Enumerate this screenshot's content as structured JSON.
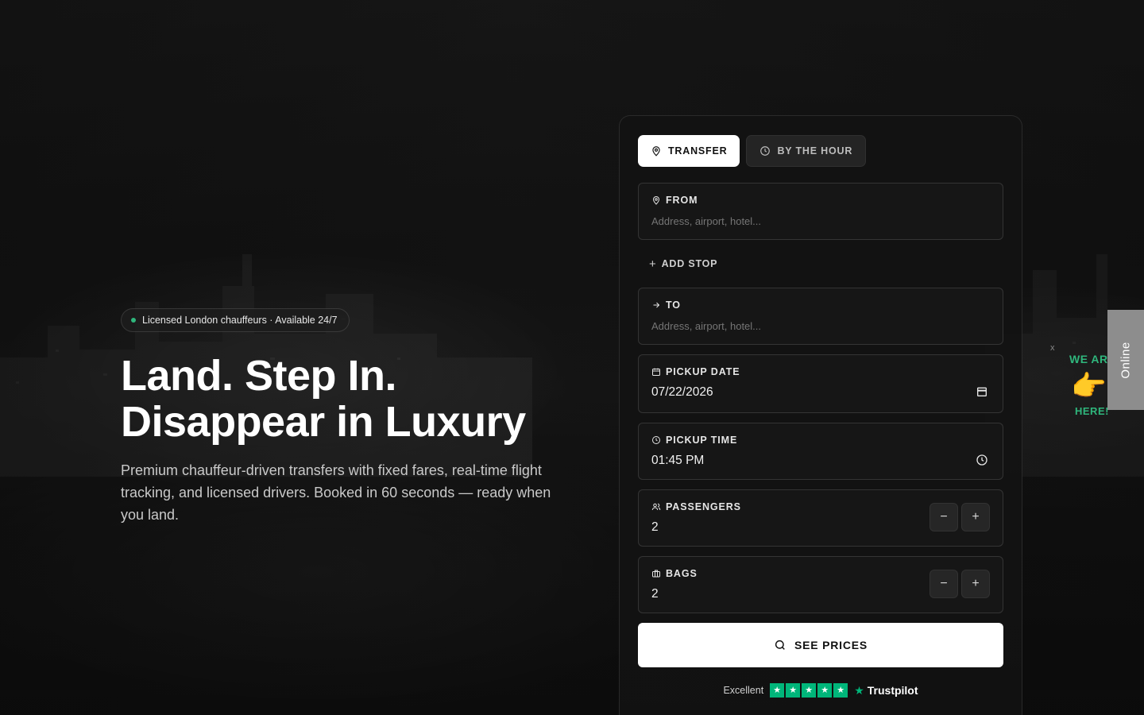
{
  "hero": {
    "badge": "Licensed London chauffeurs · Available 24/7",
    "title_line1": "Land. Step In.",
    "title_line2": "Disappear in Luxury",
    "subtitle": "Premium chauffeur-driven transfers with fixed fares, real-time flight tracking, and licensed drivers. Booked in 60 seconds — ready when you land."
  },
  "booking": {
    "tabs": [
      {
        "label": "TRANSFER",
        "icon": "map-pin-icon",
        "active": true
      },
      {
        "label": "BY THE HOUR",
        "icon": "clock-icon",
        "active": false
      }
    ],
    "from": {
      "label": "FROM",
      "placeholder": "Address, airport, hotel..."
    },
    "add_stop": "ADD STOP",
    "to": {
      "label": "TO",
      "placeholder": "Address, airport, hotel..."
    },
    "pickup_date": {
      "label": "PICKUP DATE",
      "value": "07/22/2026"
    },
    "pickup_time": {
      "label": "PICKUP TIME",
      "value": "01:45 PM"
    },
    "passengers": {
      "label": "PASSENGERS",
      "value": "2",
      "minus": "−",
      "plus": "+"
    },
    "bags": {
      "label": "BAGS",
      "value": "2",
      "minus": "−",
      "plus": "+"
    },
    "see_prices": "SEE PRICES"
  },
  "trust": {
    "rating_text": "Excellent",
    "stars": 5,
    "brand": "Trustpilot"
  },
  "chat_widget": {
    "we_are": "WE ARE",
    "here": "HERE!",
    "online_tab": "Online",
    "close": "x"
  },
  "colors": {
    "accent_green": "#2fb67c",
    "trustpilot_green": "#00b67a",
    "card_bg": "#121212",
    "button_bg": "#ffffff"
  }
}
